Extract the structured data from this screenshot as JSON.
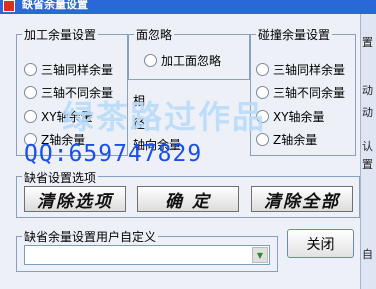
{
  "window": {
    "title": "缺省余量设置"
  },
  "right_strip": [
    "置",
    "动",
    "动",
    "认",
    "置",
    "自"
  ],
  "machining_group": {
    "title": "加工余量设置",
    "options": [
      "三轴同样余量",
      "三轴不同余量",
      "XY轴余量",
      "Z轴余量"
    ]
  },
  "face_group": {
    "title": "面忽略",
    "option": "加工面忽略",
    "labels": [
      "相",
      "径",
      "轴向余量"
    ]
  },
  "collision_group": {
    "title": "碰撞余量设置",
    "options": [
      "三轴同样余量",
      "三轴不同余量",
      "XY轴余量",
      "Z轴余量"
    ]
  },
  "watermark": {
    "text": "绿茶路过作品",
    "qq": "QQ:659747829"
  },
  "default_options": {
    "title": "缺省设置选项",
    "clear_options": "清除选项",
    "confirm": "确 定",
    "clear_all": "清除全部"
  },
  "custom": {
    "title": "缺省余量设置用户自定义",
    "combo_value": ""
  },
  "close_button": "关闭"
}
